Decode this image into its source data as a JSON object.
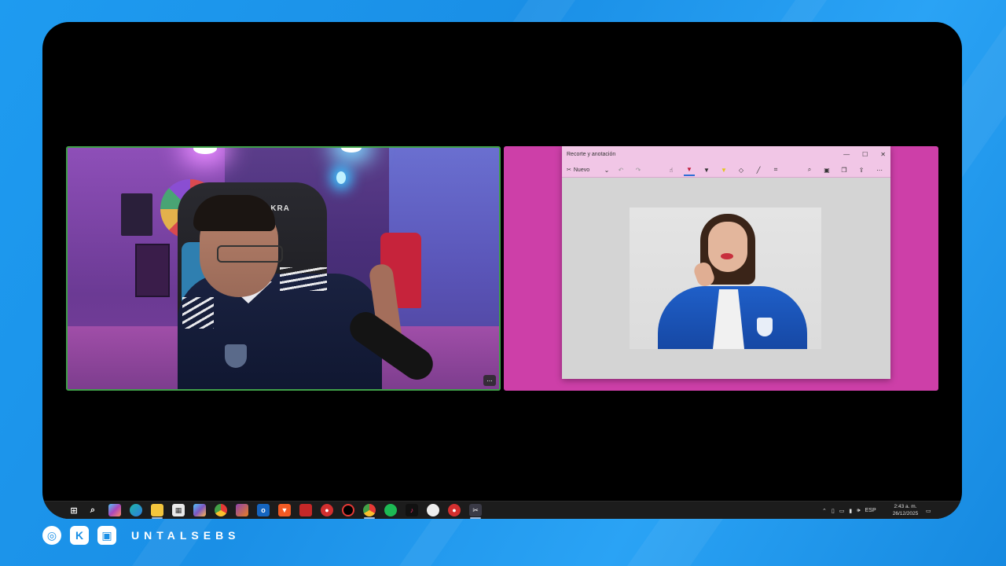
{
  "snip_window": {
    "title": "Recorte y anotación",
    "new_label": "Nuevo",
    "controls": {
      "minimize": "—",
      "maximize": "☐",
      "close": "✕"
    }
  },
  "cam": {
    "chair_brand": "AKRA",
    "more_label": "..."
  },
  "taskbar": {
    "language": "ESP",
    "time": "2:43 a. m.",
    "date": "26/12/2025"
  },
  "footer": {
    "handle": "UNTALSEBS"
  },
  "colors": {
    "background": "#1e9bf0",
    "frame": "#000000",
    "cam_border": "#3f9f48",
    "share_bg": "#cd3fa8",
    "snip_chrome": "#f1c6e6",
    "taskbar": "#1c1c1c"
  },
  "icons": {
    "taskbar_apps": [
      "windows-start-icon",
      "search-icon",
      "copilot-icon",
      "edge-icon",
      "file-explorer-icon",
      "store-icon",
      "copilot-icon",
      "chrome-icon",
      "photos-icon",
      "outlook-icon",
      "brave-icon",
      "app-icon",
      "recorder-icon",
      "opera-icon",
      "chrome-profile-icon",
      "spotify-icon",
      "tiktok-icon",
      "app-icon",
      "recorder-icon",
      "snipping-tool-icon"
    ],
    "socials": [
      "instagram-icon",
      "kick-icon",
      "twitch-icon"
    ]
  }
}
